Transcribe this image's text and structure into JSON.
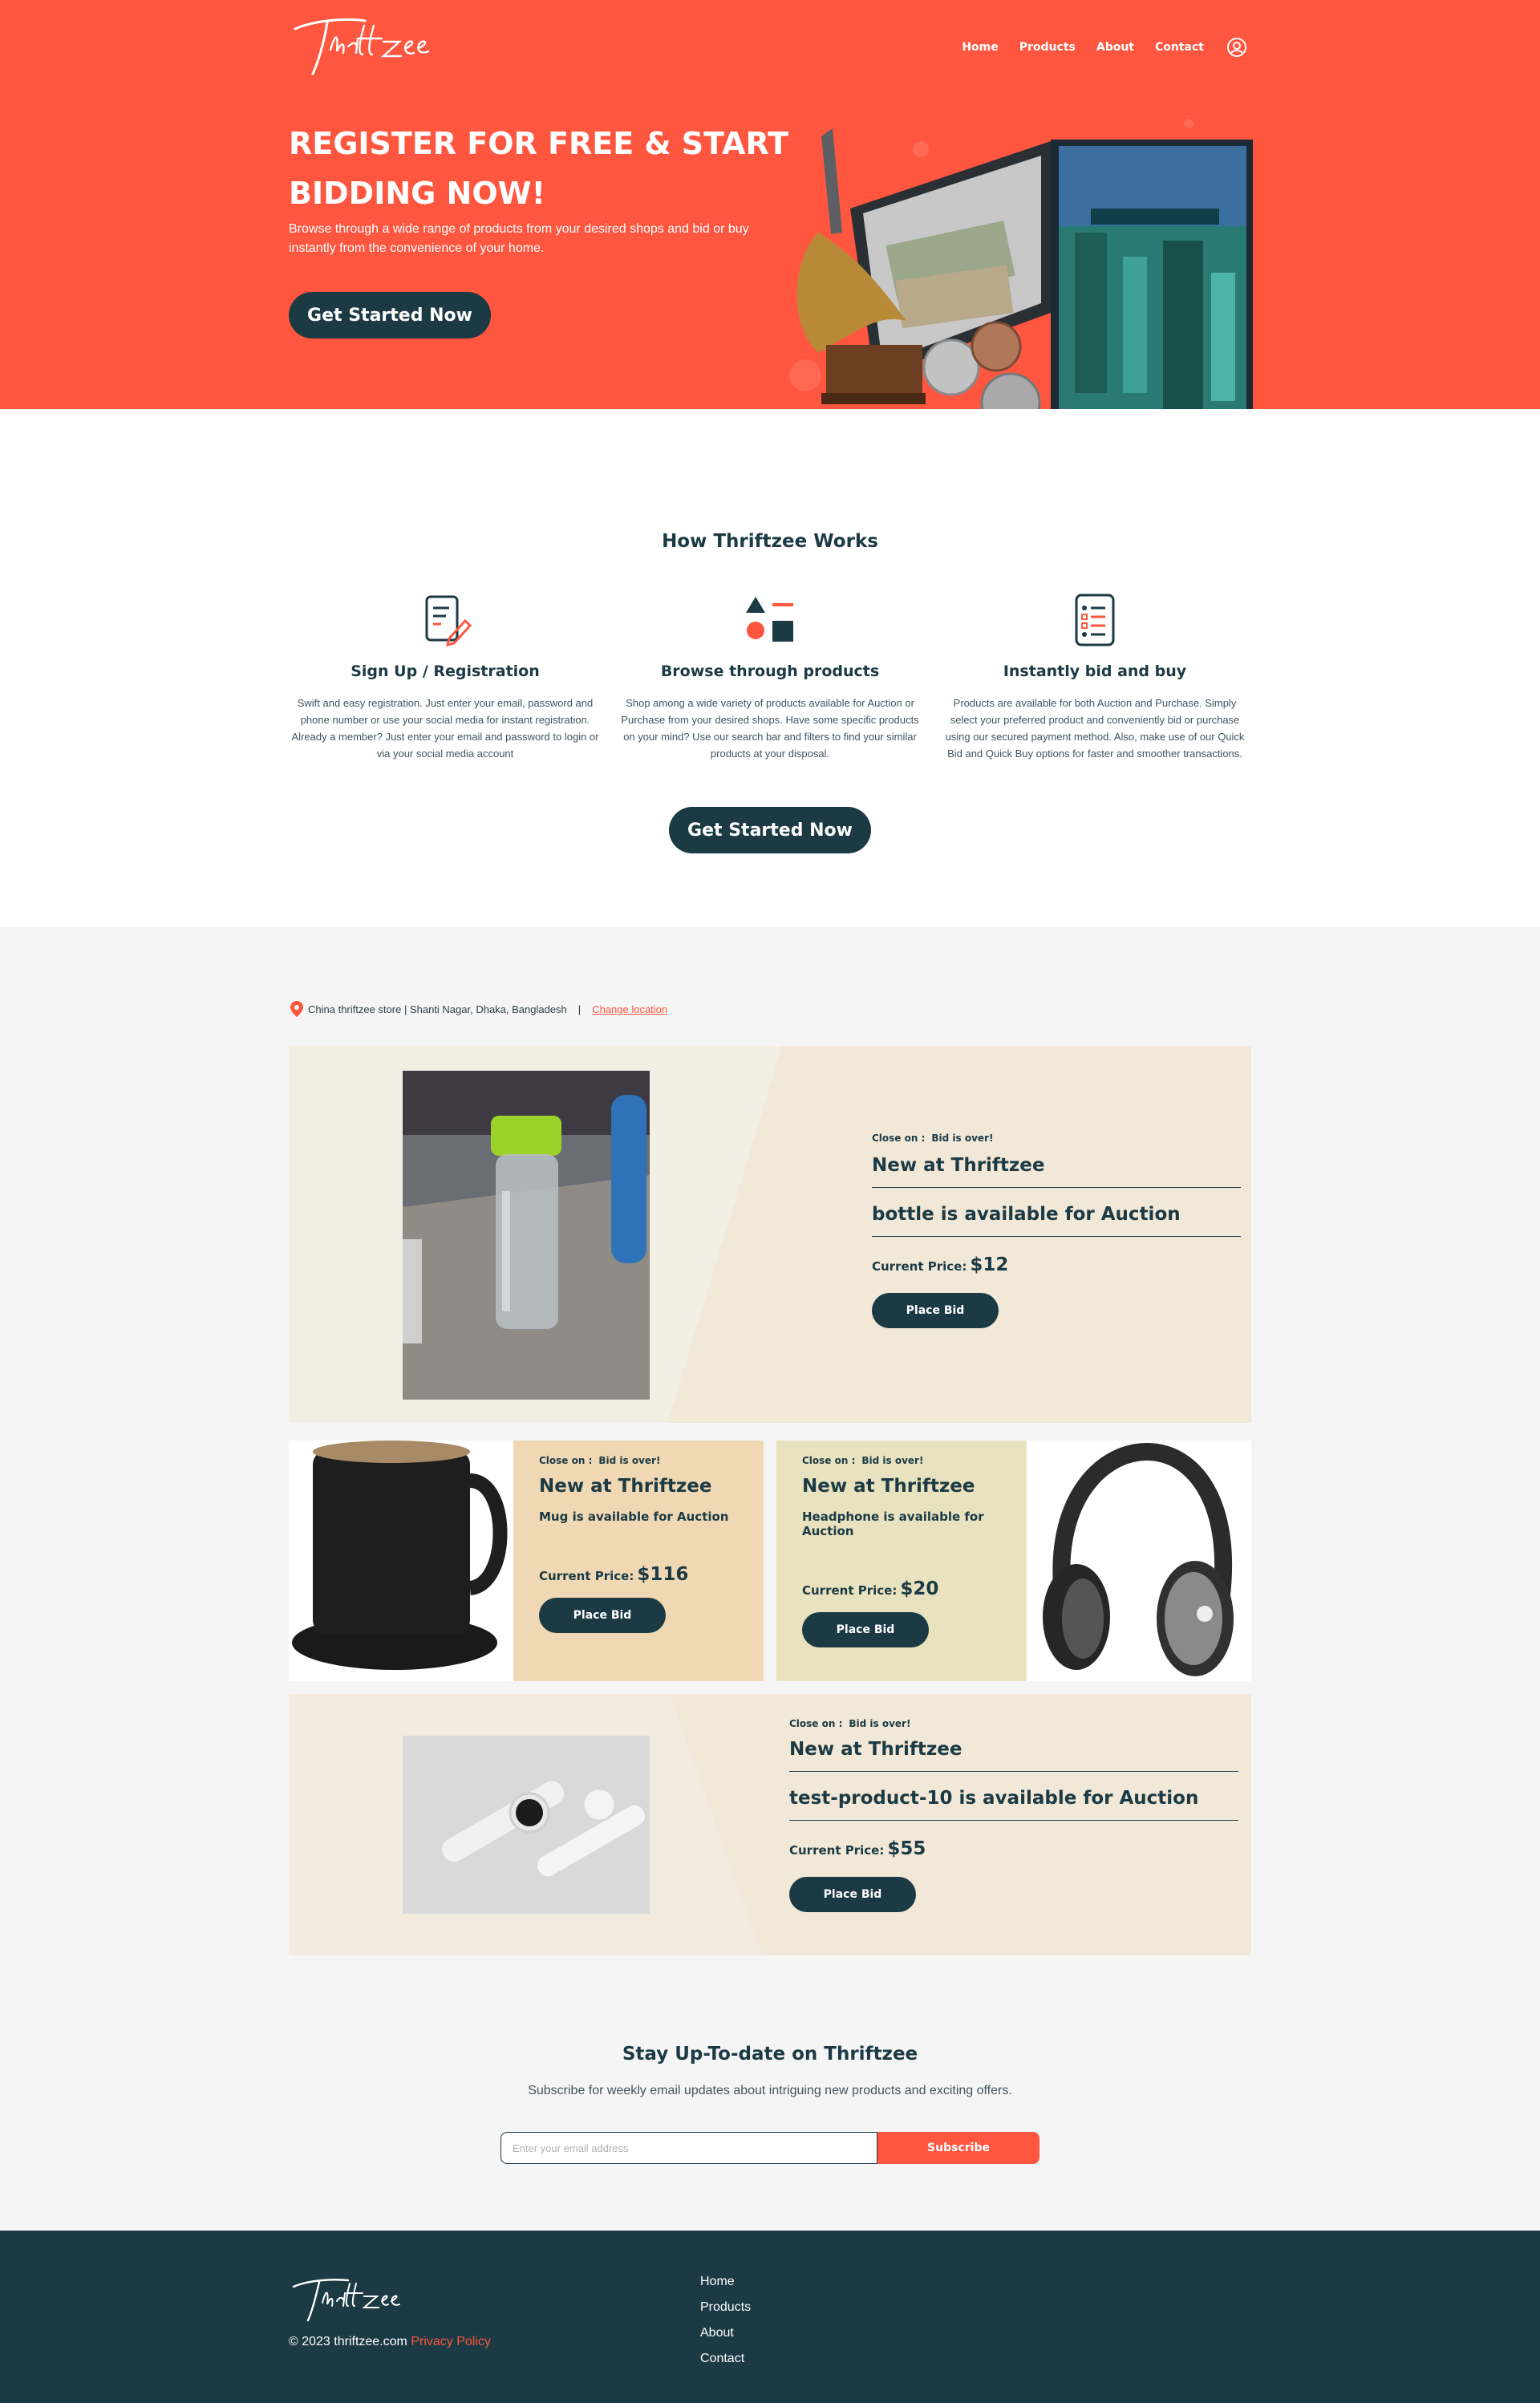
{
  "brand": {
    "name": "Thriftzee"
  },
  "nav": {
    "home": "Home",
    "products": "Products",
    "about": "About",
    "contact": "Contact"
  },
  "hero": {
    "title": "REGISTER FOR FREE & START BIDDING NOW!",
    "subtitle": "Browse through a wide range of products from your desired shops and bid or buy instantly from the convenience of your home.",
    "cta": "Get Started Now"
  },
  "how": {
    "title": "How Thriftzee Works",
    "steps": [
      {
        "title": "Sign Up / Registration",
        "text": "Swift and easy registration. Just enter your email, password and phone number or use your social media for instant registration. Already a member? Just enter your email and password to login or via your social media account"
      },
      {
        "title": "Browse through products",
        "text": "Shop among a wide variety of products available for Auction or Purchase from your desired shops. Have some specific products on your mind? Use our search bar and filters to find your similar products at your disposal."
      },
      {
        "title": "Instantly bid and buy",
        "text": "Products are available for both Auction and Purchase. Simply select your preferred product and conveniently bid or purchase using our secured payment method. Also, make use of our Quick Bid and Quick Buy options for faster and smoother transactions."
      }
    ],
    "cta": "Get Started Now"
  },
  "location": {
    "text": "China thriftzee store | Shanti Nagar, Dhaka, Bangladesh",
    "separator": "|",
    "change": "Change location"
  },
  "products": [
    {
      "close_label": "Close on :",
      "close_status": "Bid is over!",
      "headline": "New at Thriftzee",
      "availability": "bottle is available for Auction",
      "price_label": "Current Price:",
      "price": "$12",
      "bid": "Place Bid"
    },
    {
      "close_label": "Close on :",
      "close_status": "Bid is over!",
      "headline": "New at Thriftzee",
      "availability": "Mug is available for Auction",
      "price_label": "Current Price:",
      "price": "$116",
      "bid": "Place Bid"
    },
    {
      "close_label": "Close on :",
      "close_status": "Bid is over!",
      "headline": "New at Thriftzee",
      "availability": "Headphone is available for Auction",
      "price_label": "Current Price:",
      "price": "$20",
      "bid": "Place Bid"
    },
    {
      "close_label": "Close on :",
      "close_status": "Bid is over!",
      "headline": "New at Thriftzee",
      "availability": "test-product-10 is available for Auction",
      "price_label": "Current Price:",
      "price": "$55",
      "bid": "Place Bid"
    }
  ],
  "subscribe": {
    "title": "Stay Up-To-date on Thriftzee",
    "text": "Subscribe for weekly email updates about intriguing new products and exciting offers.",
    "placeholder": "Enter your email address",
    "button": "Subscribe"
  },
  "footer": {
    "copyright": "© 2023 thriftzee.com",
    "privacy": "Privacy Policy",
    "links": [
      "Home",
      "Products",
      "About",
      "Contact"
    ]
  },
  "colors": {
    "accent": "#ff5640",
    "dark": "#1b3a44",
    "cream": "#f2e8d8",
    "sand": "#f0d8b4",
    "olive": "#e8e2bf",
    "light": "#f5f5f5"
  }
}
